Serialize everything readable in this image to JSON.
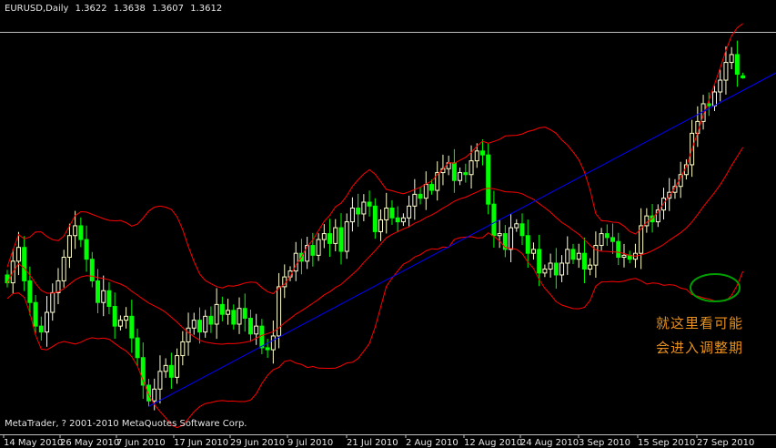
{
  "header": {
    "symbol": "EURUSD,Daily",
    "open": "1.3622",
    "high": "1.3638",
    "low": "1.3607",
    "close": "1.3612"
  },
  "copyright": "MetaTrader, ? 2001-2010 MetaQuotes Software Corp.",
  "annotation": {
    "line1": "就这里看可能",
    "line2": "会进入调整期"
  },
  "colors": {
    "background": "#000000",
    "bull_candle": "#ffffcc",
    "bear_candle": "#00ff00",
    "bands": "#ff0000",
    "trendline": "#0000ff",
    "highlight_ellipse": "#00a000",
    "annotation_text": "#e8901c"
  },
  "chart_data": {
    "type": "candlestick",
    "symbol": "EURUSD",
    "timeframe": "Daily",
    "last_bar": {
      "open": 1.3622,
      "high": 1.3638,
      "low": 1.3607,
      "close": 1.3612
    },
    "x_tick_labels": [
      "14 May 2010",
      "26 May 2010",
      "7 Jun 2010",
      "17 Jun 2010",
      "29 Jun 2010",
      "9 Jul 2010",
      "21 Jul 2010",
      "2 Aug 2010",
      "12 Aug 2010",
      "24 Aug 2010",
      "3 Sep 2010",
      "15 Sep 2010",
      "27 Sep 2010"
    ],
    "price_range": [
      1.18,
      1.385
    ],
    "closes": [
      1.257,
      1.268,
      1.275,
      1.258,
      1.247,
      1.235,
      1.232,
      1.242,
      1.252,
      1.258,
      1.27,
      1.281,
      1.286,
      1.279,
      1.269,
      1.258,
      1.247,
      1.253,
      1.245,
      1.235,
      1.238,
      1.24,
      1.229,
      1.219,
      1.205,
      1.197,
      1.203,
      1.212,
      1.215,
      1.209,
      1.22,
      1.227,
      1.234,
      1.238,
      1.232,
      1.24,
      1.236,
      1.246,
      1.241,
      1.243,
      1.236,
      1.244,
      1.239,
      1.231,
      1.235,
      1.224,
      1.223,
      1.23,
      1.255,
      1.26,
      1.263,
      1.272,
      1.268,
      1.276,
      1.271,
      1.279,
      1.282,
      1.277,
      1.285,
      1.273,
      1.288,
      1.295,
      1.292,
      1.298,
      1.296,
      1.283,
      1.289,
      1.295,
      1.29,
      1.288,
      1.29,
      1.296,
      1.302,
      1.3,
      1.307,
      1.304,
      1.313,
      1.315,
      1.318,
      1.309,
      1.313,
      1.312,
      1.319,
      1.324,
      1.322,
      1.297,
      1.281,
      1.282,
      1.274,
      1.285,
      1.287,
      1.281,
      1.272,
      1.274,
      1.262,
      1.264,
      1.267,
      1.261,
      1.267,
      1.274,
      1.269,
      1.272,
      1.264,
      1.266,
      1.276,
      1.282,
      1.28,
      1.278,
      1.27,
      1.271,
      1.269,
      1.272,
      1.286,
      1.291,
      1.288,
      1.294,
      1.3,
      1.303,
      1.306,
      1.312,
      1.317,
      1.333,
      1.339,
      1.348,
      1.347,
      1.354,
      1.36,
      1.369,
      1.373,
      1.363,
      1.361
    ],
    "upper_band": "red line, upper Bollinger band (approx. 20-period, 2 std dev)",
    "middle_band": "red line, 20-period moving average",
    "lower_band": "red line, lower Bollinger band",
    "trendline": "blue straight support line rising from the June 2010 low to the end of September 2010",
    "grid": false,
    "legend": "none"
  }
}
